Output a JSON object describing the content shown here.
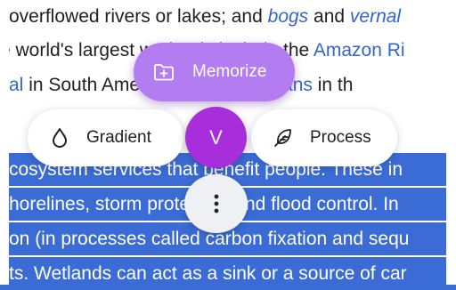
{
  "article": {
    "lines": [
      {
        "segments": [
          {
            "text": "overflowed rivers or lakes; and ",
            "link": false
          },
          {
            "text": "bogs",
            "link": true,
            "italic": true
          },
          {
            "text": " and ",
            "link": false
          },
          {
            "text": "vernal",
            "link": true,
            "italic": true
          }
        ]
      },
      {
        "segments": [
          {
            "text": "e world's largest ",
            "link": false
          },
          {
            "text": "wetlands include the ",
            "link": false
          },
          {
            "text": "Amazon Ri",
            "link": true
          }
        ]
      },
      {
        "segments": [
          {
            "text": "al",
            "link": true
          },
          {
            "text": " in South America, the ",
            "link": false
          },
          {
            "text": "Sundarbans",
            "link": true
          },
          {
            "text": " in th",
            "link": false
          }
        ]
      },
      {
        "segments": [
          {
            "text": "",
            "link": false
          }
        ]
      },
      {
        "segments": [
          {
            "text": "cosystem services that benefit people. These in",
            "link": false
          }
        ]
      },
      {
        "segments": [
          {
            "text": "horelines, storm protection and flood control. In",
            "link": false
          }
        ]
      },
      {
        "segments": [
          {
            "text": "on (in processes called carbon fixation and sequ",
            "link": false
          }
        ]
      },
      {
        "segments": [
          {
            "text": "ts. Wetlands can act as a sink or a source of car",
            "link": false
          }
        ]
      }
    ]
  },
  "menu": {
    "memorize_label": "Memorize",
    "gradient_label": "Gradient",
    "process_label": "Process",
    "center_letter": "V",
    "icons": {
      "memorize": "folder-plus-icon",
      "gradient": "droplet-icon",
      "process": "feather-icon",
      "more": "more-vert-icon"
    },
    "colors": {
      "memorize_bg": "#b37cf0",
      "center_bg": "#a82ddb",
      "selection_bg": "#3b6cd6",
      "link": "#3366cc"
    }
  }
}
